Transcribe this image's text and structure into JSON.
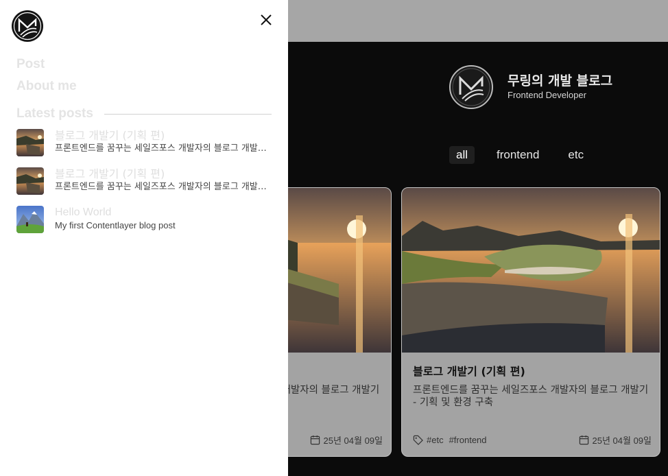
{
  "drawer": {
    "nav": [
      {
        "label": "Post"
      },
      {
        "label": "About me"
      }
    ],
    "latest_label": "Latest posts",
    "posts": [
      {
        "title": "블로그 개발기 (기획 편)",
        "desc": "프론트엔드를 꿈꾸는 세일즈포스 개발자의 블로그 개발기 - 기획 및 환경 구축"
      },
      {
        "title": "블로그 개발기 (기획 편)",
        "desc": "프론트엔드를 꿈꾸는 세일즈포스 개발자의 블로그 개발기 - 기획 및 환경 구축"
      },
      {
        "title": "Hello World",
        "desc": "My first Contentlayer blog post"
      }
    ]
  },
  "page": {
    "brand_title": "무링의 개발 블로그",
    "brand_sub": "Frontend Developer",
    "tabs": [
      {
        "label": "all",
        "active": true
      },
      {
        "label": "frontend",
        "active": false
      },
      {
        "label": "etc",
        "active": false
      }
    ],
    "cards": [
      {
        "title": "블로그 개발기 (기획 편)",
        "desc": "프론트엔드를 꿈꾸는 세일즈포스 개발자의 블로그 개발기 - 기획 및 환경 구축",
        "date": "25년 04월 09일"
      },
      {
        "title": "블로그 개발기 (기획 편)",
        "desc": "프론트엔드를 꿈꾸는 세일즈포스 개발자의 블로그 개발기 - 기획 및 환경 구축",
        "tags": [
          "#etc",
          "#frontend"
        ],
        "date": "25년 04월 09일"
      }
    ]
  },
  "icons": {
    "logo": "m-logo-icon",
    "close": "close-icon",
    "tag": "tag-icon",
    "calendar": "calendar-icon"
  },
  "colors": {
    "drawer_bg": "#ffffff",
    "overlay_bg": "#0b0b0b",
    "header_bg": "#a6a6a6",
    "card_bg": "#a3a3a3"
  }
}
